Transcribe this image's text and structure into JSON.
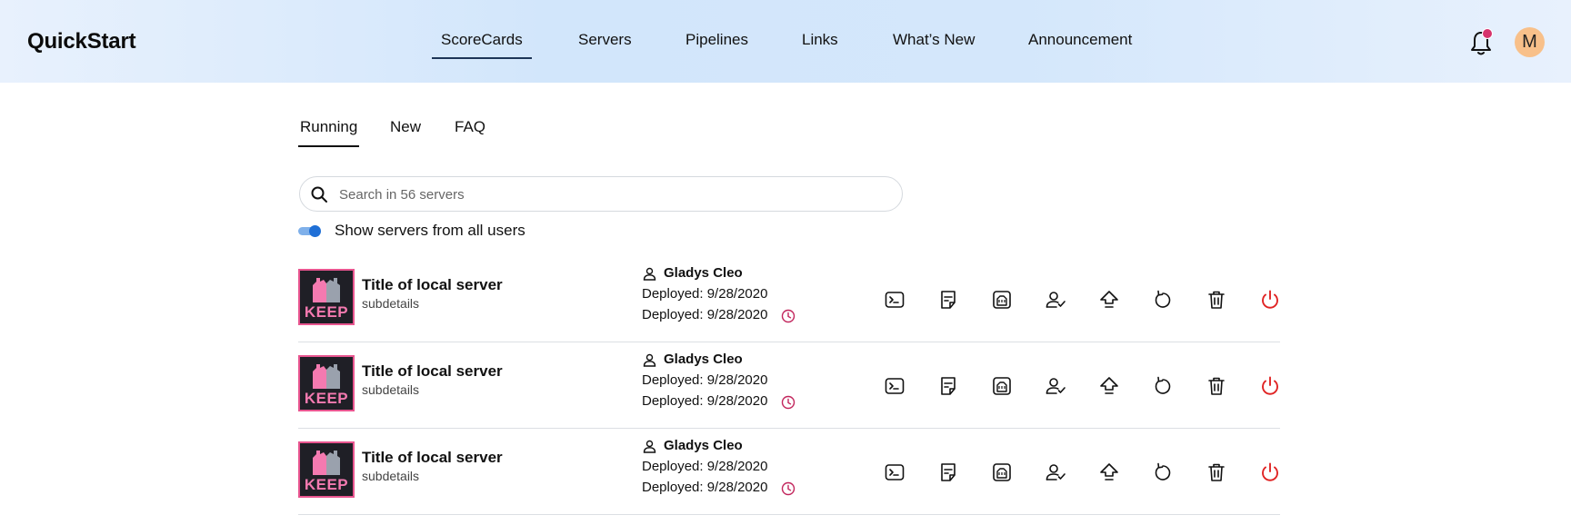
{
  "app": {
    "title": "QuickStart"
  },
  "nav": {
    "items": [
      {
        "label": "ScoreCards",
        "active": true
      },
      {
        "label": "Servers"
      },
      {
        "label": "Pipelines"
      },
      {
        "label": "Links"
      },
      {
        "label": "What’s New"
      },
      {
        "label": "Announcement"
      }
    ]
  },
  "header": {
    "avatar_initial": "M",
    "notification_icon": "bell-icon",
    "notification_dot_color": "#d6336c"
  },
  "tabs": [
    {
      "label": "Running",
      "active": true
    },
    {
      "label": "New"
    },
    {
      "label": "FAQ"
    }
  ],
  "search": {
    "placeholder": "Search in 56 servers",
    "value": ""
  },
  "filter": {
    "label": "Show servers from all users",
    "enabled": true
  },
  "servers": [
    {
      "logo_text": "KEEP",
      "title": "Title of local server",
      "subtitle": "subdetails",
      "owner": "Gladys Cleo",
      "deployed_1": "Deployed: 9/28/2020",
      "deployed_2": "Deployed: 9/28/2020"
    },
    {
      "logo_text": "KEEP",
      "title": "Title of local server",
      "subtitle": "subdetails",
      "owner": "Gladys Cleo",
      "deployed_1": "Deployed: 9/28/2020",
      "deployed_2": "Deployed: 9/28/2020"
    },
    {
      "logo_text": "KEEP",
      "title": "Title of local server",
      "subtitle": "subdetails",
      "owner": "Gladys Cleo",
      "deployed_1": "Deployed: 9/28/2020",
      "deployed_2": "Deployed: 9/28/2020"
    }
  ],
  "row_actions": [
    "terminal-icon",
    "notes-icon",
    "storage-icon",
    "assign-user-icon",
    "upload-icon",
    "restart-icon",
    "delete-icon",
    "power-icon"
  ],
  "colors": {
    "accent": "#1f6fd6",
    "power": "#e02424",
    "clock": "#c2255c",
    "logo_border": "#e8558f"
  }
}
